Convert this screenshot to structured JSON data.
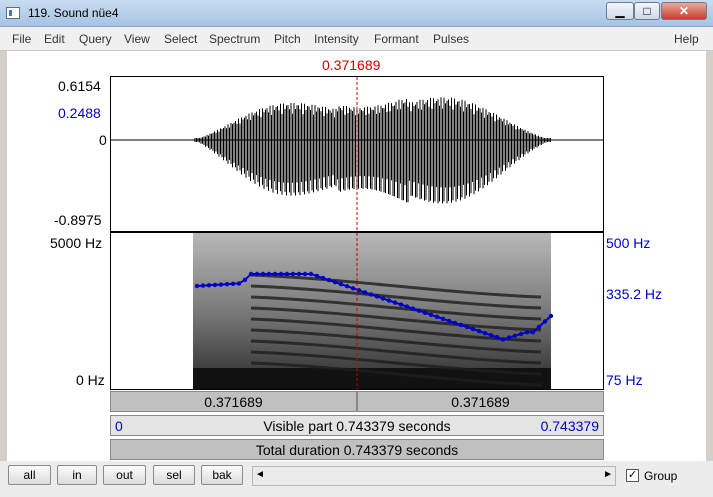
{
  "window": {
    "title": "119. Sound nüe4",
    "min_label": "▁",
    "max_label": "□",
    "close_label": "✕"
  },
  "menu": [
    "File",
    "Edit",
    "Query",
    "View",
    "Select",
    "Spectrum",
    "Pitch",
    "Intensity",
    "Formant",
    "Pulses"
  ],
  "help": "Help",
  "cursor_time": "0.371689",
  "waveform": {
    "max": "0.6154",
    "cursor_value": "0.2488",
    "zero": "0",
    "min": "-0.8975"
  },
  "spectrogram": {
    "top_freq": "5000 Hz",
    "bottom_freq": "0 Hz"
  },
  "pitch": {
    "top": "500 Hz",
    "cursor": "335.2 Hz",
    "bottom": "75 Hz"
  },
  "time_bar": {
    "left": "0.371689",
    "right": "0.371689"
  },
  "visible": {
    "start": "0",
    "label": "Visible part 0.743379 seconds",
    "end": "0.743379"
  },
  "total": "Total duration 0.743379 seconds",
  "buttons": [
    "all",
    "in",
    "out",
    "sel",
    "bak"
  ],
  "scroll": {
    "left_arrow": "◄",
    "right_arrow": "►"
  },
  "group": {
    "label": "Group",
    "checked": "✓"
  },
  "colors": {
    "cursor": "#d00000",
    "pitch": "#0000c8"
  }
}
